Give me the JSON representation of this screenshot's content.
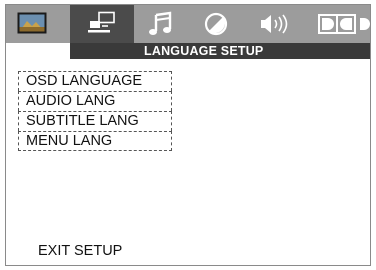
{
  "tabs": [
    {
      "icon": "tv-picture-icon",
      "active": false
    },
    {
      "icon": "language-setup-icon",
      "active": true
    },
    {
      "icon": "music-note-icon",
      "active": false
    },
    {
      "icon": "contrast-icon",
      "active": false
    },
    {
      "icon": "speaker-icon",
      "active": false
    },
    {
      "icon": "dolby-icon",
      "active": false
    }
  ],
  "section_title": "LANGUAGE SETUP",
  "menu": {
    "items": [
      {
        "label": "OSD LANGUAGE"
      },
      {
        "label": "AUDIO LANG"
      },
      {
        "label": "SUBTITLE LANG"
      },
      {
        "label": "MENU LANG"
      }
    ]
  },
  "exit_label": "EXIT SETUP",
  "colors": {
    "tabbar": "#9c9c9c",
    "active_tab": "#4b4b4b",
    "title_bar": "#3a3a3a",
    "icon": "#ffffff"
  }
}
